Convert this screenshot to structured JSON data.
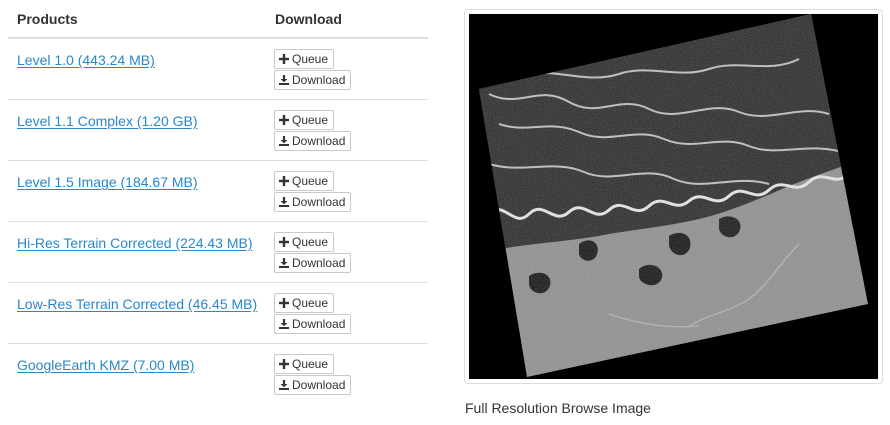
{
  "table": {
    "header_products": "Products",
    "header_download": "Download",
    "queue_label": "Queue",
    "download_label": "Download",
    "rows": [
      {
        "name": "Level 1.0 (443.24 MB)"
      },
      {
        "name": "Level 1.1 Complex (1.20 GB)"
      },
      {
        "name": "Level 1.5 Image (184.67 MB)"
      },
      {
        "name": "Hi-Res Terrain Corrected (224.43 MB)"
      },
      {
        "name": "Low-Res Terrain Corrected (46.45 MB)"
      },
      {
        "name": "GoogleEarth KMZ (7.00 MB)"
      }
    ]
  },
  "browse": {
    "caption": "Full Resolution Browse Image"
  },
  "icons": {
    "queue": "plus-icon",
    "download": "download-icon"
  },
  "colors": {
    "link": "#2a87c8",
    "border": "#dddddd"
  }
}
